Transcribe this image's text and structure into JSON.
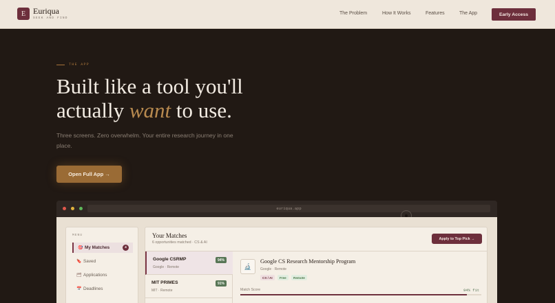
{
  "nav": {
    "logo_letter": "E",
    "brand": "Euriqua",
    "tagline": "SEEK AND FIND",
    "links": [
      "The Problem",
      "How It Works",
      "Features",
      "The App"
    ],
    "cta": "Early Access"
  },
  "hero": {
    "eyebrow": "THE APP",
    "headline_line1": "Built like a tool you'll",
    "headline_pre": "actually ",
    "headline_accent": "want",
    "headline_post": " to use.",
    "subtext": "Three screens. Zero overwhelm. Your entire research journey in one place.",
    "button": "Open Full App →"
  },
  "browser": {
    "url": "euriqua.app",
    "sidebar": {
      "menu_label": "MENU",
      "items": [
        {
          "icon": "🎯",
          "label": "My Matches",
          "badge": "4",
          "active": true
        },
        {
          "icon": "🔖",
          "label": "Saved"
        },
        {
          "icon": "🗂",
          "label": "Applications"
        },
        {
          "icon": "📅",
          "label": "Deadlines"
        }
      ]
    },
    "main": {
      "title": "Your Matches",
      "subtitle": "6 opportunities matched · CS & AI",
      "apply_button": "Apply to Top Pick →",
      "matches": [
        {
          "name": "Google CSRMP",
          "meta": "Google · Remote",
          "score": "94%"
        },
        {
          "name": "MIT PRIMES",
          "meta": "MIT · Remote",
          "score": "91%"
        }
      ],
      "detail": {
        "icon": "🔬",
        "title": "Google CS Research Mentorship Program",
        "org": "Google · Remote",
        "tags": [
          "CS / AI",
          "Free",
          "Remote"
        ],
        "score_label": "Match Score",
        "score_text": "94% fit",
        "score_fraction": 0.94
      }
    }
  }
}
